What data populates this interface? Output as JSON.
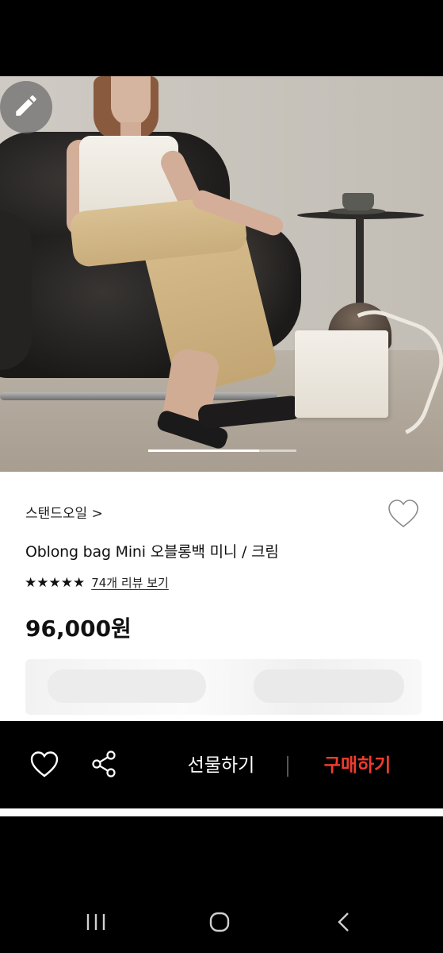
{
  "product": {
    "brand": "스탠드오일",
    "brand_chevron": ">",
    "title": "Oblong bag Mini 오블롱백 미니 / 크림",
    "stars": "★★★★★",
    "rating_stars": 5,
    "review_link": "74개 리뷰 보기",
    "price": "96,000원"
  },
  "gallery": {
    "current_index": 0
  },
  "actions": {
    "gift_label": "선물하기",
    "buy_label": "구매하기"
  },
  "colors": {
    "buy_accent": "#f03c2e",
    "background": "#000000",
    "card": "#ffffff"
  },
  "icons": {
    "edit": "pencil-icon",
    "wishlist": "heart-outline-icon",
    "share": "share-icon",
    "nav_recents": "recents-icon",
    "nav_home": "home-icon",
    "nav_back": "back-icon"
  }
}
